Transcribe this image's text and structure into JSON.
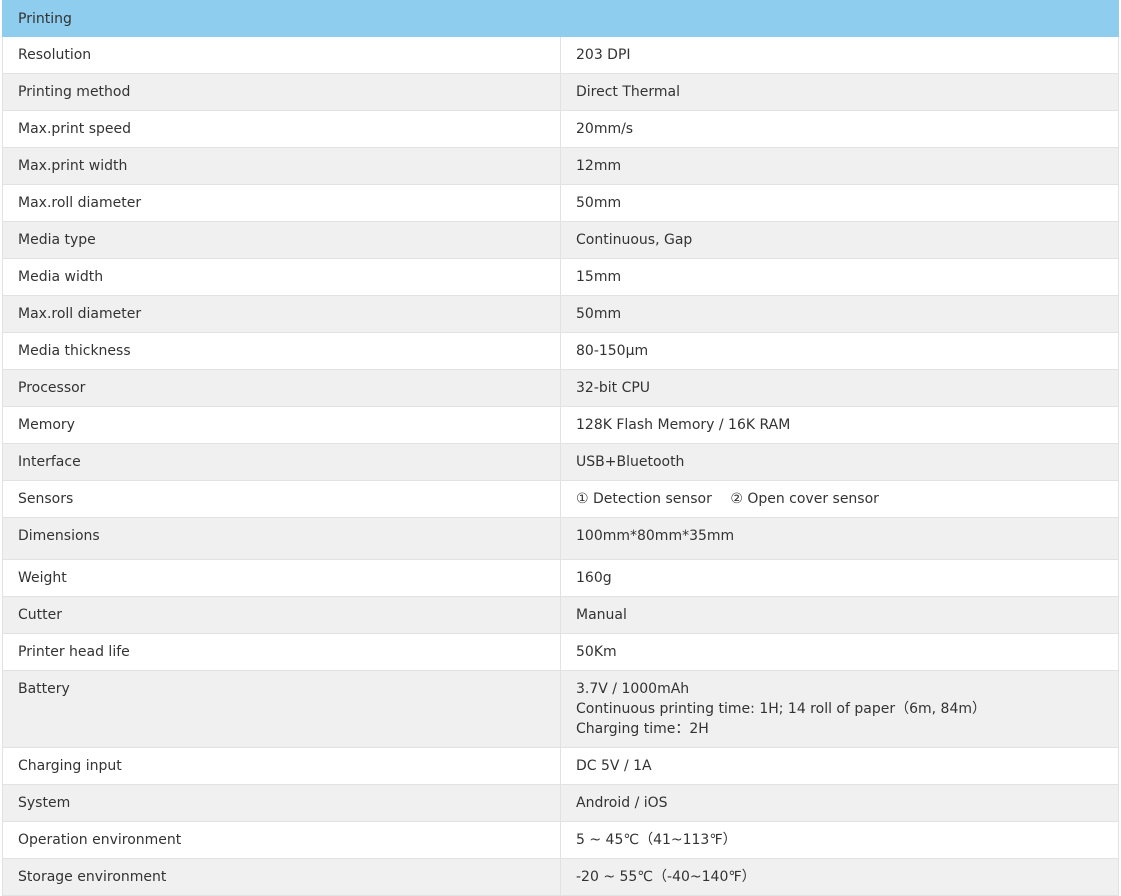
{
  "section_title": "Printing",
  "specs": [
    {
      "label": "Resolution",
      "value": "203 DPI"
    },
    {
      "label": "Printing method",
      "value": "Direct Thermal"
    },
    {
      "label": "Max.print speed",
      "value": "20mm/s"
    },
    {
      "label": "Max.print width",
      "value": "12mm"
    },
    {
      "label": "Max.roll diameter",
      "value": "50mm"
    },
    {
      "label": "Media type",
      "value": "Continuous, Gap"
    },
    {
      "label": "Media width",
      "value": "15mm"
    },
    {
      "label": "Max.roll diameter",
      "value": "50mm"
    },
    {
      "label": "Media thickness",
      "value": "80-150μm"
    },
    {
      "label": "Processor",
      "value": "32-bit CPU"
    },
    {
      "label": "Memory",
      "value": "128K Flash Memory / 16K RAM"
    },
    {
      "label": "Interface",
      "value": "USB+Bluetooth"
    },
    {
      "label": "Sensors",
      "values": [
        "① Detection sensor",
        "② Open cover sensor"
      ]
    },
    {
      "label": "Dimensions",
      "value": "100mm*80mm*35mm"
    },
    {
      "label": "Weight",
      "value": "160g"
    },
    {
      "label": "Cutter",
      "value": "Manual"
    },
    {
      "label": "Printer head life",
      "value": "50Km"
    },
    {
      "label": "Battery",
      "lines": [
        "3.7V / 1000mAh",
        "Continuous printing time: 1H; 14 roll of paper（6m, 84m）",
        "Charging time：2H"
      ]
    },
    {
      "label": "Charging input",
      "value": "DC 5V / 1A"
    },
    {
      "label": "System",
      "value": "Android / iOS"
    },
    {
      "label": "Operation environment",
      "value": "5 ~ 45℃（41~113℉）"
    },
    {
      "label": "Storage environment",
      "value": "-20 ~ 55℃（-40~140℉）"
    }
  ]
}
